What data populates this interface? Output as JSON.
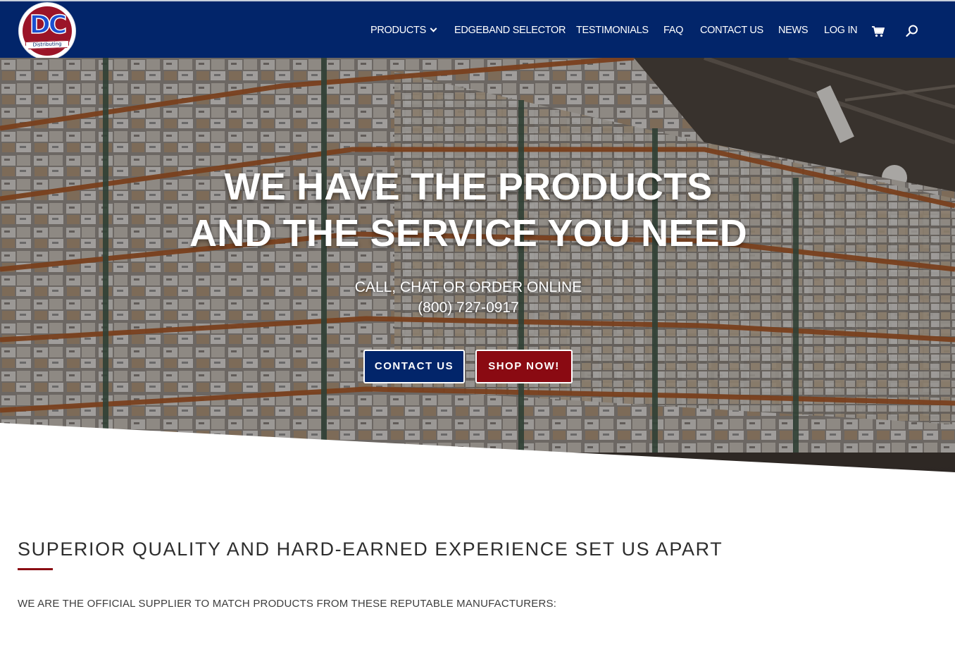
{
  "brand": {
    "logo_letters": "DC",
    "logo_tagline": "Distributing"
  },
  "nav": {
    "items": [
      {
        "label": "PRODUCTS",
        "has_dropdown": true
      },
      {
        "label": "EDGEBAND SELECTOR"
      },
      {
        "label": "TESTIMONIALS"
      },
      {
        "label": "FAQ"
      },
      {
        "label": "CONTACT US"
      },
      {
        "label": "NEWS"
      },
      {
        "label": "LOG IN"
      }
    ],
    "cart_icon": "shopping-cart-icon",
    "search_icon": "magnifier-icon"
  },
  "hero": {
    "title_line1": "WE HAVE THE PRODUCTS",
    "title_line2": "AND THE SERVICE YOU NEED",
    "sub_line1": "CALL, CHAT OR ORDER ONLINE",
    "phone": "(800) 727-0917",
    "contact_button": "CONTACT US",
    "shop_button": "SHOP NOW!"
  },
  "section": {
    "heading": "SUPERIOR QUALITY AND HARD-EARNED EXPERIENCE SET US APART",
    "text": "WE ARE THE OFFICIAL SUPPLIER TO MATCH PRODUCTS FROM THESE REPUTABLE MANUFACTURERS:"
  },
  "colors": {
    "header_bg": "#02256a",
    "contact_button_bg": "#02256a",
    "shop_button_bg": "#8a0a12",
    "accent_rule": "#8a0a12"
  }
}
